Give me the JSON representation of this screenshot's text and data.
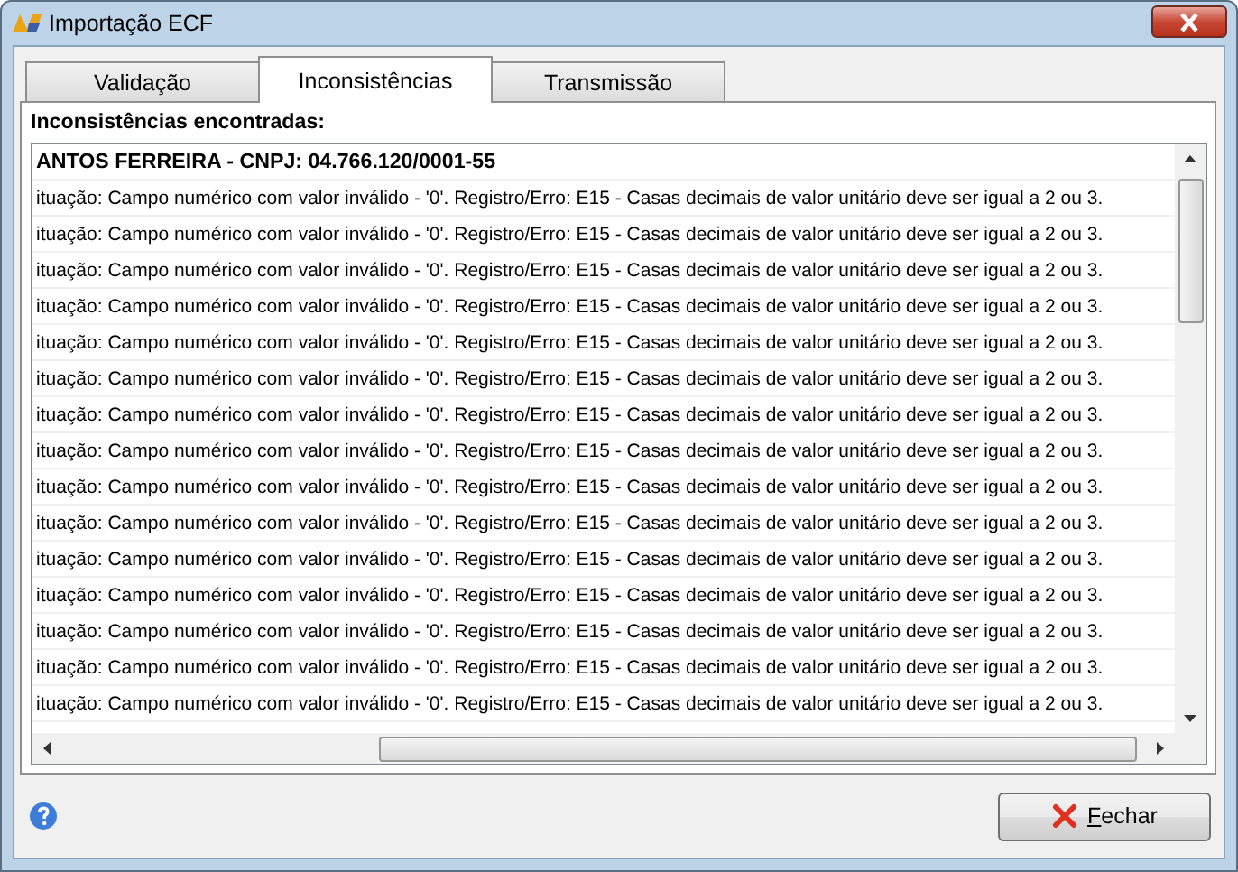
{
  "window": {
    "title": "Importação ECF"
  },
  "tabs": [
    {
      "label": "Validação",
      "selected": false
    },
    {
      "label": "Inconsistências",
      "selected": true
    },
    {
      "label": "Transmissão",
      "selected": false
    }
  ],
  "list_label": "Inconsistências encontradas:",
  "rows": [
    {
      "kind": "header",
      "text": "ANTOS FERREIRA - CNPJ: 04.766.120/0001-55"
    },
    {
      "kind": "message",
      "text": "ituação: Campo numérico com valor inválido - '0'. Registro/Erro: E15 - Casas decimais de valor unitário deve ser igual a 2 ou 3."
    },
    {
      "kind": "message",
      "text": "ituação: Campo numérico com valor inválido - '0'. Registro/Erro: E15 - Casas decimais de valor unitário deve ser igual a 2 ou 3."
    },
    {
      "kind": "message",
      "text": "ituação: Campo numérico com valor inválido - '0'. Registro/Erro: E15 - Casas decimais de valor unitário deve ser igual a 2 ou 3."
    },
    {
      "kind": "message",
      "text": "ituação: Campo numérico com valor inválido - '0'. Registro/Erro: E15 - Casas decimais de valor unitário deve ser igual a 2 ou 3."
    },
    {
      "kind": "message",
      "text": "ituação: Campo numérico com valor inválido - '0'. Registro/Erro: E15 - Casas decimais de valor unitário deve ser igual a 2 ou 3."
    },
    {
      "kind": "message",
      "text": "ituação: Campo numérico com valor inválido - '0'. Registro/Erro: E15 - Casas decimais de valor unitário deve ser igual a 2 ou 3."
    },
    {
      "kind": "message",
      "text": "ituação: Campo numérico com valor inválido - '0'. Registro/Erro: E15 - Casas decimais de valor unitário deve ser igual a 2 ou 3."
    },
    {
      "kind": "message",
      "text": "ituação: Campo numérico com valor inválido - '0'. Registro/Erro: E15 - Casas decimais de valor unitário deve ser igual a 2 ou 3."
    },
    {
      "kind": "message",
      "text": "ituação: Campo numérico com valor inválido - '0'. Registro/Erro: E15 - Casas decimais de valor unitário deve ser igual a 2 ou 3."
    },
    {
      "kind": "message",
      "text": "ituação: Campo numérico com valor inválido - '0'. Registro/Erro: E15 - Casas decimais de valor unitário deve ser igual a 2 ou 3."
    },
    {
      "kind": "message",
      "text": "ituação: Campo numérico com valor inválido - '0'. Registro/Erro: E15 - Casas decimais de valor unitário deve ser igual a 2 ou 3."
    },
    {
      "kind": "message",
      "text": "ituação: Campo numérico com valor inválido - '0'. Registro/Erro: E15 - Casas decimais de valor unitário deve ser igual a 2 ou 3."
    },
    {
      "kind": "message",
      "text": "ituação: Campo numérico com valor inválido - '0'. Registro/Erro: E15 - Casas decimais de valor unitário deve ser igual a 2 ou 3."
    },
    {
      "kind": "message",
      "text": "ituação: Campo numérico com valor inválido - '0'. Registro/Erro: E15 - Casas decimais de valor unitário deve ser igual a 2 ou 3."
    },
    {
      "kind": "message",
      "text": "ituação: Campo numérico com valor inválido - '0'. Registro/Erro: E15 - Casas decimais de valor unitário deve ser igual a 2 ou 3."
    }
  ],
  "buttons": [
    {
      "label": "Fechar"
    }
  ]
}
